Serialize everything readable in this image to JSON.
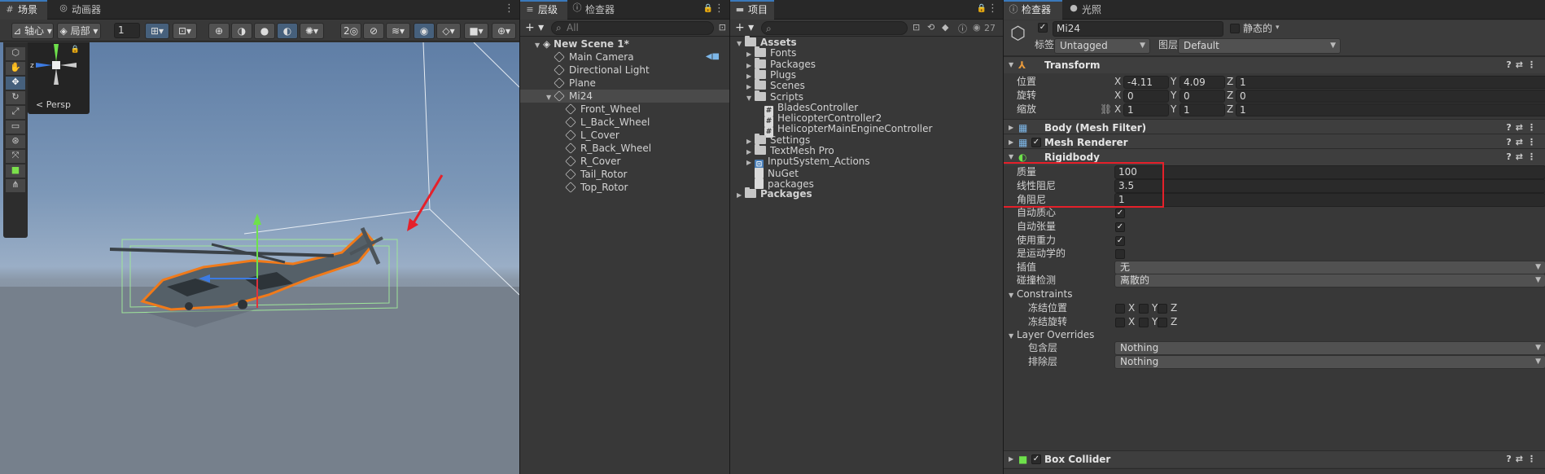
{
  "scene_panel": {
    "tabs": [
      {
        "label": "场景",
        "icon": "grid-icon"
      },
      {
        "label": "动画器",
        "icon": "animator-icon"
      }
    ],
    "toolbar": {
      "pivot_label": "轴心",
      "space_label": "局部",
      "snap_value": "1"
    },
    "gizmo": {
      "axis_z": "z",
      "persp_label": "Persp"
    }
  },
  "hierarchy_panel": {
    "tabs": [
      {
        "label": "层级"
      },
      {
        "label": "检查器"
      }
    ],
    "search_placeholder": "All",
    "items": [
      {
        "label": "New Scene 1*",
        "depth": 0,
        "bold": true,
        "expanded": true,
        "icon": "unity-scene-icon"
      },
      {
        "label": "Main Camera",
        "depth": 1,
        "icon": "cube-icon"
      },
      {
        "label": "Directional Light",
        "depth": 1,
        "icon": "cube-icon"
      },
      {
        "label": "Plane",
        "depth": 1,
        "icon": "cube-icon"
      },
      {
        "label": "Mi24",
        "depth": 1,
        "icon": "cube-icon",
        "expanded": true,
        "selected": true
      },
      {
        "label": "Front_Wheel",
        "depth": 2,
        "icon": "cube-icon"
      },
      {
        "label": "L_Back_Wheel",
        "depth": 2,
        "icon": "cube-icon"
      },
      {
        "label": "L_Cover",
        "depth": 2,
        "icon": "cube-icon"
      },
      {
        "label": "R_Back_Wheel",
        "depth": 2,
        "icon": "cube-icon"
      },
      {
        "label": "R_Cover",
        "depth": 2,
        "icon": "cube-icon"
      },
      {
        "label": "Tail_Rotor",
        "depth": 2,
        "icon": "cube-icon"
      },
      {
        "label": "Top_Rotor",
        "depth": 2,
        "icon": "cube-icon"
      }
    ]
  },
  "project_panel": {
    "tabs": [
      {
        "label": "项目"
      }
    ],
    "badge_count": "27",
    "items": [
      {
        "label": "Assets",
        "depth": 0,
        "bold": true,
        "expanded": true,
        "type": "folder"
      },
      {
        "label": "Fonts",
        "depth": 1,
        "type": "folder"
      },
      {
        "label": "Packages",
        "depth": 1,
        "type": "folder"
      },
      {
        "label": "Plugs",
        "depth": 1,
        "type": "folder"
      },
      {
        "label": "Scenes",
        "depth": 1,
        "type": "folder"
      },
      {
        "label": "Scripts",
        "depth": 1,
        "type": "folder",
        "expanded": true
      },
      {
        "label": "BladesController",
        "depth": 2,
        "type": "script"
      },
      {
        "label": "HelicopterController2",
        "depth": 2,
        "type": "script"
      },
      {
        "label": "HelicopterMainEngineController",
        "depth": 2,
        "type": "script"
      },
      {
        "label": "Settings",
        "depth": 1,
        "type": "folder"
      },
      {
        "label": "TextMesh Pro",
        "depth": 1,
        "type": "folder"
      },
      {
        "label": "InputSystem_Actions",
        "depth": 1,
        "type": "asset"
      },
      {
        "label": "NuGet",
        "depth": 1,
        "type": "file",
        "notoggle": true
      },
      {
        "label": "packages",
        "depth": 1,
        "type": "file",
        "notoggle": true
      },
      {
        "label": "Packages",
        "depth": 0,
        "bold": true,
        "type": "folder"
      }
    ]
  },
  "inspector_panel": {
    "tabs": [
      {
        "label": "检查器"
      },
      {
        "label": "光照"
      }
    ],
    "object_name": "Mi24",
    "static_label": "静态的",
    "tag_label": "标签",
    "tag_value": "Untagged",
    "layer_label": "图层",
    "layer_value": "Default",
    "transform": {
      "title": "Transform",
      "rows": [
        {
          "label": "位置",
          "x": "-4.11",
          "y": "4.09",
          "z": "1"
        },
        {
          "label": "旋转",
          "x": "0",
          "y": "0",
          "z": "0"
        },
        {
          "label": "缩放",
          "x": "1",
          "y": "1",
          "z": "1"
        }
      ]
    },
    "components": [
      {
        "title": "Body (Mesh Filter)"
      },
      {
        "title": "Mesh Renderer"
      },
      {
        "title": "Rigidbody"
      }
    ],
    "rigidbody": {
      "mass_label": "质量",
      "mass": "100",
      "linear_damping_label": "线性阻尼",
      "linear_damping": "3.5",
      "angular_damping_label": "角阻尼",
      "angular_damping": "1",
      "auto_com_label": "自动质心",
      "auto_tensor_label": "自动张量",
      "use_gravity_label": "使用重力",
      "kinematic_label": "是运动学的",
      "interpolate_label": "插值",
      "interpolate_value": "无",
      "collision_label": "碰撞检测",
      "collision_value": "离散的",
      "constraints_label": "Constraints",
      "freeze_pos_label": "冻结位置",
      "freeze_rot_label": "冻结旋转",
      "layer_overrides_label": "Layer Overrides",
      "include_label": "包含层",
      "include_value": "Nothing",
      "exclude_label": "排除层",
      "exclude_value": "Nothing"
    },
    "box_collider": {
      "title": "Box Collider"
    }
  },
  "colors": {
    "accent": "#3a79bb",
    "annotation_red": "#e5202a",
    "selection_outline": "#f07a1a"
  }
}
